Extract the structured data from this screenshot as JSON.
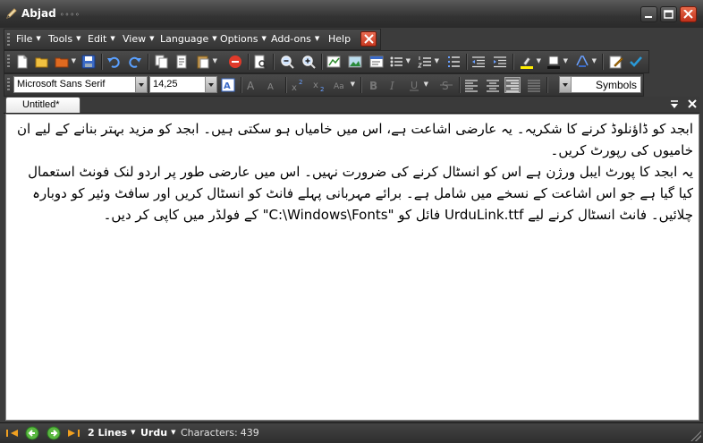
{
  "window": {
    "title": "Abjad",
    "title_suffix": "◦◦◦◦"
  },
  "menubar": {
    "items": [
      {
        "label": "File"
      },
      {
        "label": "Tools"
      },
      {
        "label": "Edit"
      },
      {
        "label": "View"
      },
      {
        "label": "Language"
      },
      {
        "label": "Options"
      },
      {
        "label": "Add-ons"
      },
      {
        "label": "Help"
      }
    ]
  },
  "toolbar_format": {
    "font_name": "Microsoft Sans Serif",
    "font_size": "14,25",
    "symbols_label": "Symbols"
  },
  "tabs": [
    {
      "label": "Untitled*"
    }
  ],
  "editor": {
    "paragraphs": [
      "ابجد کو ڈاؤنلوڈ کرنے کا شکریہ۔ یہ عارضی اشاعت ہے، اس میں خامیاں ہو سکتی ہیں۔ ابجد کو مزید بہتر بنانے کے لیے ان خامیوں کی رپورٹ کریں۔",
      "یہ ابجد کا پورٹ ایبل ورژن ہے اس کو انسٹال کرنے کی ضرورت نہیں۔ اس میں عارضی طور پر اردو لنک فونٹ استعمال کیا گیا ہے جو اس اشاعت کے نسخے میں شامل ہے۔ برائے مہربانی پہلے فانٹ کو انسٹال کریں اور سافٹ وئیر کو دوبارہ چلائیں۔ فانٹ انسٹال کرنے لیے UrduLink.ttf فائل کو \"C:\\Windows\\Fonts\" کے فولڈر میں کاپی کر دیں۔"
    ]
  },
  "status": {
    "lines": "2 Lines",
    "language": "Urdu",
    "characters_label": "Characters:",
    "characters_count": "439"
  }
}
